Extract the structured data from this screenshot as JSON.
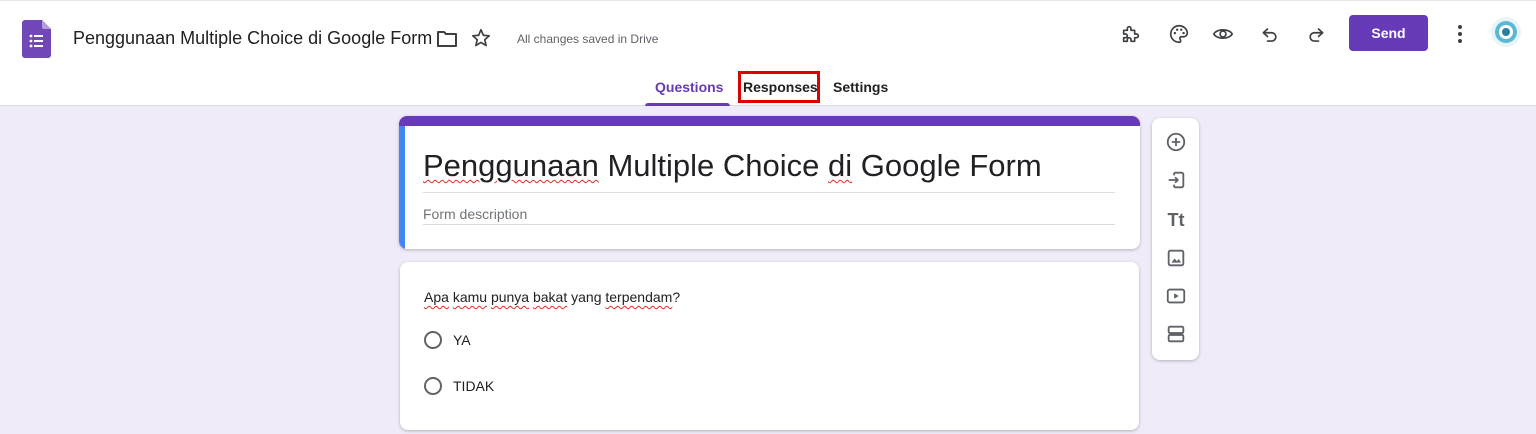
{
  "header": {
    "doc_title": "Penggunaan Multiple Choice di Google Form",
    "save_status": "All changes saved in Drive",
    "send_label": "Send",
    "icons": [
      "forms-app-icon",
      "folder-icon",
      "star-icon",
      "addon-icon",
      "palette-icon",
      "preview-eye-icon",
      "undo-icon",
      "redo-icon",
      "more-vert-icon",
      "avatar"
    ]
  },
  "tabs": {
    "questions": "Questions",
    "responses": "Responses",
    "settings": "Settings",
    "active": "Questions",
    "highlighted": "Responses"
  },
  "form": {
    "title": "Penggunaan Multiple Choice di Google Form",
    "description_placeholder": "Form description"
  },
  "question": {
    "text": "Apa kamu punya bakat yang terpendam?",
    "options": [
      "YA",
      "TIDAK"
    ]
  },
  "side_toolbar": {
    "title_text_icon_label": "Tt",
    "icons": [
      "add-question-icon",
      "import-questions-icon",
      "add-title-text-icon",
      "add-image-icon",
      "add-video-icon",
      "add-section-icon"
    ]
  },
  "colors": {
    "accent": "#673ab7",
    "background": "#f0ebf8",
    "title_left_band": "#4285f4",
    "highlight": "#e00000"
  }
}
